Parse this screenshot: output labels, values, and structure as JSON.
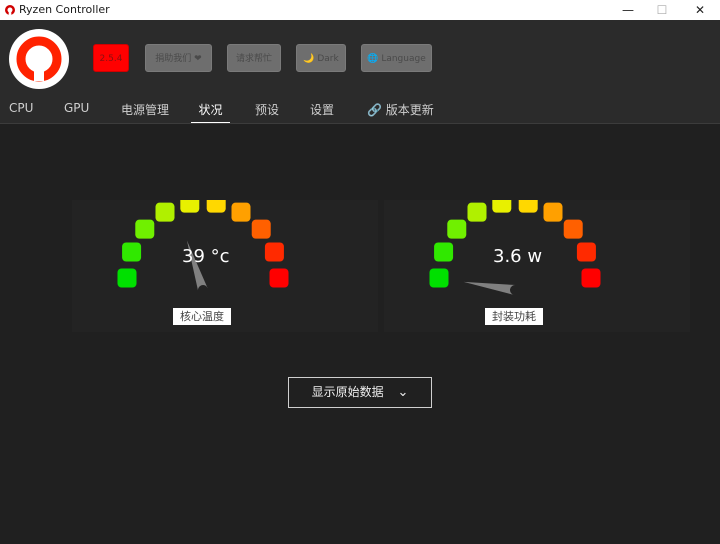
{
  "window": {
    "title": "Ryzen Controller",
    "minimize_glyph": "—",
    "maximize_glyph": "☐",
    "close_glyph": "✕"
  },
  "header": {
    "version_label": "2.5.4",
    "support_label": "捐助我们 ❤",
    "help_label": "请求帮忙",
    "dark_label": "🌙 Dark",
    "language_label": "🌐 Language"
  },
  "tabs": [
    {
      "label": "CPU"
    },
    {
      "label": "GPU"
    },
    {
      "label": "电源管理"
    },
    {
      "label": "状况"
    },
    {
      "label": "预设"
    },
    {
      "label": "设置"
    },
    {
      "label": "🔗 版本更新"
    }
  ],
  "gauges": [
    {
      "value_text": "39 °c",
      "label": "核心温度",
      "level": 0.4
    },
    {
      "value_text": "3.6 w",
      "label": "封装功耗",
      "level": 0.05
    }
  ],
  "gauge_colors": [
    "#00e000",
    "#30e800",
    "#70f000",
    "#b0f000",
    "#e8f000",
    "#ffd800",
    "#ffa000",
    "#ff6000",
    "#ff2a00",
    "#ff0000"
  ],
  "raw_button": {
    "label": "显示原始数据",
    "chevron": "⌄"
  }
}
